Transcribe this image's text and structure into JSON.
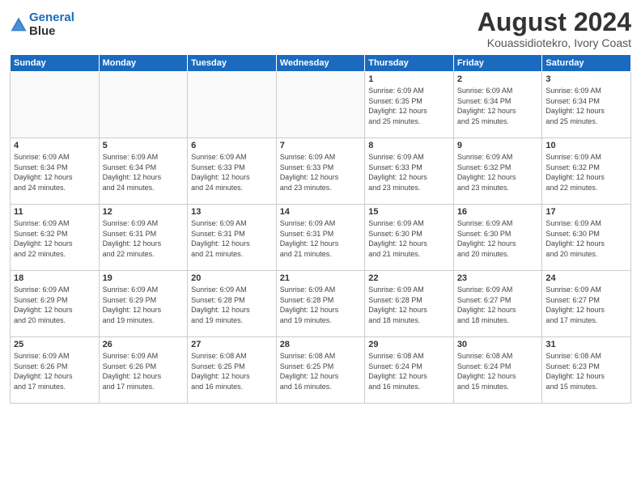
{
  "header": {
    "logo_line1": "General",
    "logo_line2": "Blue",
    "title": "August 2024",
    "subtitle": "Kouassidiotekro, Ivory Coast"
  },
  "weekdays": [
    "Sunday",
    "Monday",
    "Tuesday",
    "Wednesday",
    "Thursday",
    "Friday",
    "Saturday"
  ],
  "weeks": [
    [
      {
        "day": "",
        "info": ""
      },
      {
        "day": "",
        "info": ""
      },
      {
        "day": "",
        "info": ""
      },
      {
        "day": "",
        "info": ""
      },
      {
        "day": "1",
        "info": "Sunrise: 6:09 AM\nSunset: 6:35 PM\nDaylight: 12 hours\nand 25 minutes."
      },
      {
        "day": "2",
        "info": "Sunrise: 6:09 AM\nSunset: 6:34 PM\nDaylight: 12 hours\nand 25 minutes."
      },
      {
        "day": "3",
        "info": "Sunrise: 6:09 AM\nSunset: 6:34 PM\nDaylight: 12 hours\nand 25 minutes."
      }
    ],
    [
      {
        "day": "4",
        "info": "Sunrise: 6:09 AM\nSunset: 6:34 PM\nDaylight: 12 hours\nand 24 minutes."
      },
      {
        "day": "5",
        "info": "Sunrise: 6:09 AM\nSunset: 6:34 PM\nDaylight: 12 hours\nand 24 minutes."
      },
      {
        "day": "6",
        "info": "Sunrise: 6:09 AM\nSunset: 6:33 PM\nDaylight: 12 hours\nand 24 minutes."
      },
      {
        "day": "7",
        "info": "Sunrise: 6:09 AM\nSunset: 6:33 PM\nDaylight: 12 hours\nand 23 minutes."
      },
      {
        "day": "8",
        "info": "Sunrise: 6:09 AM\nSunset: 6:33 PM\nDaylight: 12 hours\nand 23 minutes."
      },
      {
        "day": "9",
        "info": "Sunrise: 6:09 AM\nSunset: 6:32 PM\nDaylight: 12 hours\nand 23 minutes."
      },
      {
        "day": "10",
        "info": "Sunrise: 6:09 AM\nSunset: 6:32 PM\nDaylight: 12 hours\nand 22 minutes."
      }
    ],
    [
      {
        "day": "11",
        "info": "Sunrise: 6:09 AM\nSunset: 6:32 PM\nDaylight: 12 hours\nand 22 minutes."
      },
      {
        "day": "12",
        "info": "Sunrise: 6:09 AM\nSunset: 6:31 PM\nDaylight: 12 hours\nand 22 minutes."
      },
      {
        "day": "13",
        "info": "Sunrise: 6:09 AM\nSunset: 6:31 PM\nDaylight: 12 hours\nand 21 minutes."
      },
      {
        "day": "14",
        "info": "Sunrise: 6:09 AM\nSunset: 6:31 PM\nDaylight: 12 hours\nand 21 minutes."
      },
      {
        "day": "15",
        "info": "Sunrise: 6:09 AM\nSunset: 6:30 PM\nDaylight: 12 hours\nand 21 minutes."
      },
      {
        "day": "16",
        "info": "Sunrise: 6:09 AM\nSunset: 6:30 PM\nDaylight: 12 hours\nand 20 minutes."
      },
      {
        "day": "17",
        "info": "Sunrise: 6:09 AM\nSunset: 6:30 PM\nDaylight: 12 hours\nand 20 minutes."
      }
    ],
    [
      {
        "day": "18",
        "info": "Sunrise: 6:09 AM\nSunset: 6:29 PM\nDaylight: 12 hours\nand 20 minutes."
      },
      {
        "day": "19",
        "info": "Sunrise: 6:09 AM\nSunset: 6:29 PM\nDaylight: 12 hours\nand 19 minutes."
      },
      {
        "day": "20",
        "info": "Sunrise: 6:09 AM\nSunset: 6:28 PM\nDaylight: 12 hours\nand 19 minutes."
      },
      {
        "day": "21",
        "info": "Sunrise: 6:09 AM\nSunset: 6:28 PM\nDaylight: 12 hours\nand 19 minutes."
      },
      {
        "day": "22",
        "info": "Sunrise: 6:09 AM\nSunset: 6:28 PM\nDaylight: 12 hours\nand 18 minutes."
      },
      {
        "day": "23",
        "info": "Sunrise: 6:09 AM\nSunset: 6:27 PM\nDaylight: 12 hours\nand 18 minutes."
      },
      {
        "day": "24",
        "info": "Sunrise: 6:09 AM\nSunset: 6:27 PM\nDaylight: 12 hours\nand 17 minutes."
      }
    ],
    [
      {
        "day": "25",
        "info": "Sunrise: 6:09 AM\nSunset: 6:26 PM\nDaylight: 12 hours\nand 17 minutes."
      },
      {
        "day": "26",
        "info": "Sunrise: 6:09 AM\nSunset: 6:26 PM\nDaylight: 12 hours\nand 17 minutes."
      },
      {
        "day": "27",
        "info": "Sunrise: 6:08 AM\nSunset: 6:25 PM\nDaylight: 12 hours\nand 16 minutes."
      },
      {
        "day": "28",
        "info": "Sunrise: 6:08 AM\nSunset: 6:25 PM\nDaylight: 12 hours\nand 16 minutes."
      },
      {
        "day": "29",
        "info": "Sunrise: 6:08 AM\nSunset: 6:24 PM\nDaylight: 12 hours\nand 16 minutes."
      },
      {
        "day": "30",
        "info": "Sunrise: 6:08 AM\nSunset: 6:24 PM\nDaylight: 12 hours\nand 15 minutes."
      },
      {
        "day": "31",
        "info": "Sunrise: 6:08 AM\nSunset: 6:23 PM\nDaylight: 12 hours\nand 15 minutes."
      }
    ]
  ]
}
